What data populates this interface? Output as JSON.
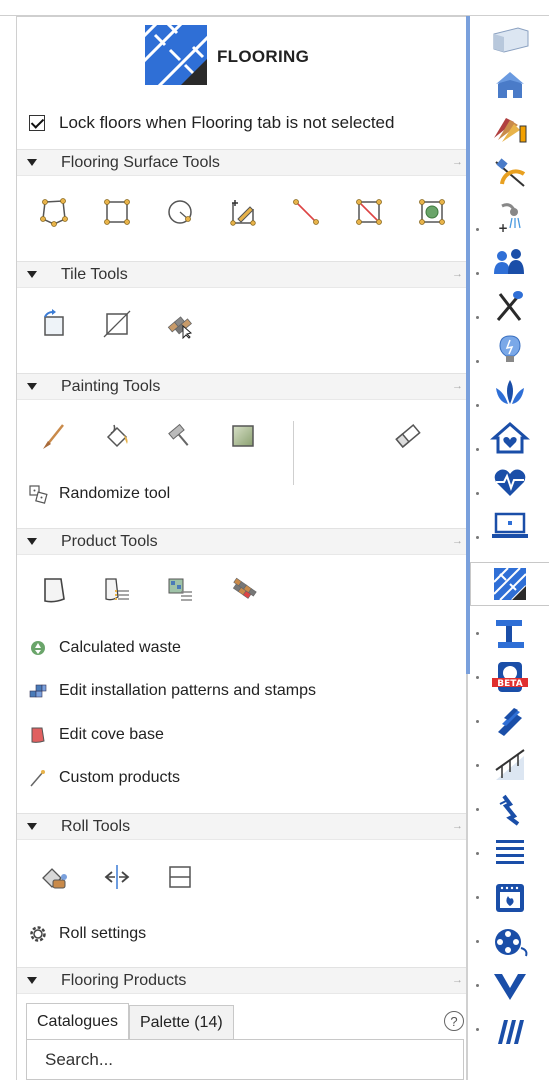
{
  "header": {
    "title": "FLOORING"
  },
  "lock_option": {
    "label": "Lock floors when Flooring tab is not selected",
    "checked": true
  },
  "sections": {
    "surface": {
      "label": "Flooring Surface Tools"
    },
    "tile": {
      "label": "Tile Tools"
    },
    "painting": {
      "label": "Painting Tools",
      "randomize": "Randomize tool"
    },
    "product": {
      "label": "Product Tools",
      "items": [
        "Calculated waste",
        "Edit installation patterns and stamps",
        "Edit cove base",
        "Custom products"
      ]
    },
    "roll": {
      "label": "Roll Tools",
      "settings": "Roll settings"
    },
    "products": {
      "label": "Flooring Products",
      "tabs": [
        "Catalogues",
        "Palette (14)"
      ],
      "help": "?",
      "search_placeholder": "Search..."
    }
  },
  "sidebar_icons": [
    "walls-icon",
    "house-icon",
    "materials-icon",
    "measuring-icon",
    "plumbing-icon",
    "people-icon",
    "kitchen-icon",
    "lighting-icon",
    "spa-icon",
    "home-care-icon",
    "health-icon",
    "computer-icon",
    "flooring-icon",
    "beam-icon",
    "beta-icon",
    "stairs-icon",
    "railing-icon",
    "electrical-icon",
    "stack-icon",
    "oven-icon",
    "film-icon",
    "chevron-icon",
    "lines-icon"
  ],
  "colors": {
    "accent": "#7aa0dc",
    "flooring_blue": "#2f6fd6",
    "badge_red": "#e03030"
  },
  "sidebar_badge": "BETA"
}
